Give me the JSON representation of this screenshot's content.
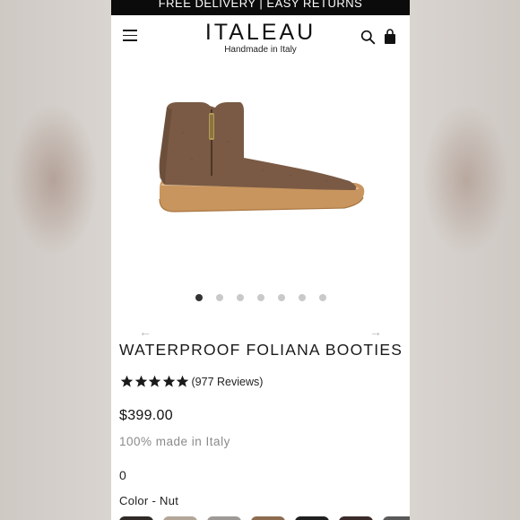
{
  "promo_bar": {
    "text": "FREE DELIVERY | EASY RETURNS"
  },
  "header": {
    "brand": "ITALEAU",
    "tagline": "Handmade in Italy",
    "menu_icon": "hamburger-menu-icon",
    "search_icon": "search-icon",
    "cart_icon": "shopping-bag-icon"
  },
  "gallery": {
    "image": "brown-suede-ankle-boot",
    "dots_total": 7,
    "active_dot": 1,
    "prev_arrow": "←",
    "next_arrow": "→"
  },
  "product": {
    "title": "WATERPROOF FOLIANA BOOTIES",
    "rating": 5,
    "reviews": "(977 Reviews)",
    "price": "$399.00",
    "origin": "100% made in Italy",
    "quantity": "0",
    "color_label": "Color - Nut"
  },
  "colors": {
    "boot": "#7a5a44",
    "sole": "#c9955e",
    "swatches": [
      "#2f2a27",
      "#b3a79a",
      "#9c9996",
      "#8d6b4f",
      "#1f1f1f",
      "#3a2b2a",
      "#5a5a5a"
    ]
  }
}
